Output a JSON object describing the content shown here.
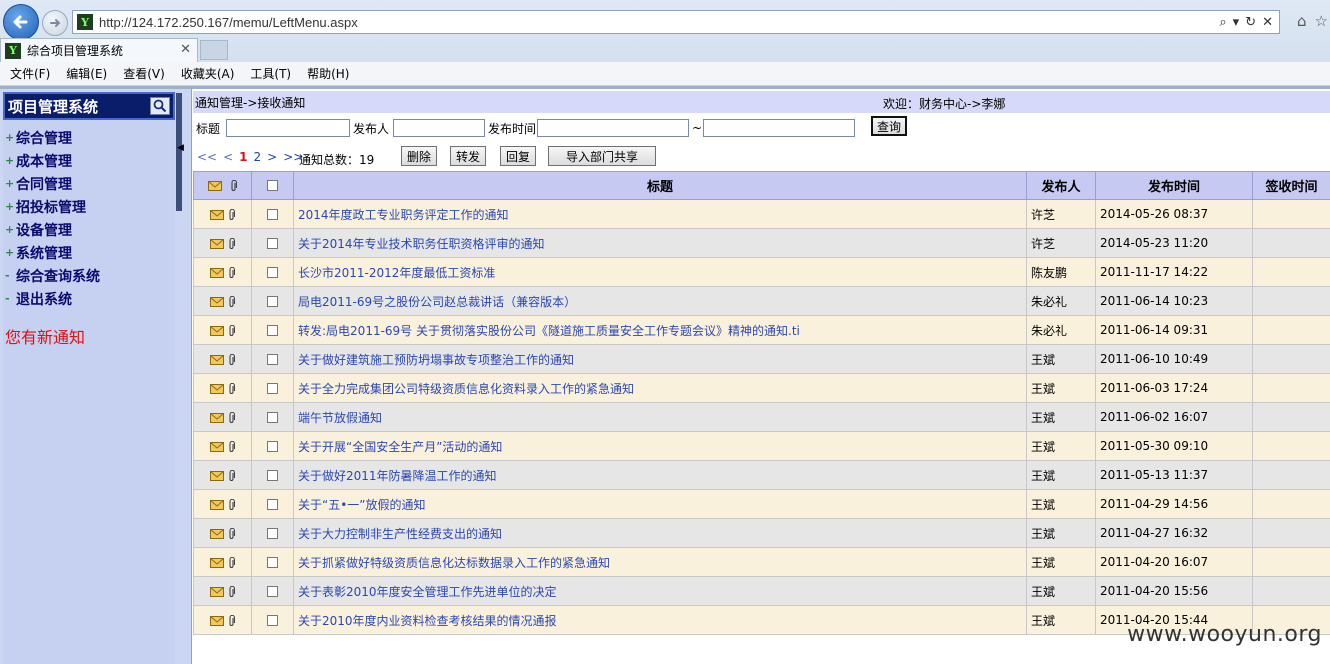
{
  "browser": {
    "url": "http://124.172.250.167/memu/LeftMenu.aspx",
    "tab_title": "综合项目管理系统",
    "favicon_text": "Y"
  },
  "menu": [
    "文件(F)",
    "编辑(E)",
    "查看(V)",
    "收藏夹(A)",
    "工具(T)",
    "帮助(H)"
  ],
  "sidebar": {
    "title": "项目管理系统",
    "items": [
      {
        "label": "综合管理",
        "toggle": "+"
      },
      {
        "label": "成本管理",
        "toggle": "+"
      },
      {
        "label": "合同管理",
        "toggle": "+"
      },
      {
        "label": "招投标管理",
        "toggle": "+"
      },
      {
        "label": "设备管理",
        "toggle": "+"
      },
      {
        "label": "系统管理",
        "toggle": "+"
      },
      {
        "label": "综合查询系统",
        "toggle": "-"
      },
      {
        "label": "退出系统",
        "toggle": "-"
      }
    ],
    "notice": "您有新通知"
  },
  "header": {
    "breadcrumb": "通知管理->接收通知",
    "welcome": "欢迎：财务中心->李娜"
  },
  "filters": {
    "title_label": "标题",
    "publisher_label": "发布人",
    "time_label": "发布时间",
    "range_sep": "~",
    "query_button": "查询"
  },
  "pager": {
    "first": "<<",
    "prev": "<",
    "current": "1",
    "page2": "2",
    "next": ">",
    "last": ">>",
    "total_label": "通知总数：19"
  },
  "actions": {
    "delete": "删除",
    "forward": "转发",
    "reply": "回复",
    "import_share": "导入部门共享"
  },
  "table": {
    "columns": [
      "标题",
      "发布人",
      "发布时间",
      "签收时间"
    ],
    "rows": [
      {
        "title": "2014年度政工专业职务评定工作的通知",
        "publisher": "许芝",
        "time": "2014-05-26 08:37",
        "signed": ""
      },
      {
        "title": "关于2014年专业技术职务任职资格评审的通知",
        "publisher": "许芝",
        "time": "2014-05-23 11:20",
        "signed": ""
      },
      {
        "title": "长沙市2011-2012年度最低工资标准",
        "publisher": "陈友鹏",
        "time": "2011-11-17 14:22",
        "signed": ""
      },
      {
        "title": "局电2011-69号之股份公司赵总裁讲话（兼容版本）",
        "publisher": "朱必礼",
        "time": "2011-06-14 10:23",
        "signed": ""
      },
      {
        "title": "转发:局电2011-69号 关于贯彻落实股份公司《隧道施工质量安全工作专题会议》精神的通知.ti",
        "publisher": "朱必礼",
        "time": "2011-06-14 09:31",
        "signed": ""
      },
      {
        "title": "关于做好建筑施工预防坍塌事故专项整治工作的通知",
        "publisher": "王斌",
        "time": "2011-06-10 10:49",
        "signed": ""
      },
      {
        "title": "关于全力完成集团公司特级资质信息化资料录入工作的紧急通知",
        "publisher": "王斌",
        "time": "2011-06-03 17:24",
        "signed": ""
      },
      {
        "title": "端午节放假通知",
        "publisher": "王斌",
        "time": "2011-06-02 16:07",
        "signed": ""
      },
      {
        "title": "关于开展“全国安全生产月”活动的通知",
        "publisher": "王斌",
        "time": "2011-05-30 09:10",
        "signed": ""
      },
      {
        "title": "关于做好2011年防暑降温工作的通知",
        "publisher": "王斌",
        "time": "2011-05-13 11:37",
        "signed": ""
      },
      {
        "title": "关于“五•一”放假的通知",
        "publisher": "王斌",
        "time": "2011-04-29 14:56",
        "signed": ""
      },
      {
        "title": "关于大力控制非生产性经费支出的通知",
        "publisher": "王斌",
        "time": "2011-04-27 16:32",
        "signed": ""
      },
      {
        "title": "关于抓紧做好特级资质信息化达标数据录入工作的紧急通知",
        "publisher": "王斌",
        "time": "2011-04-20 16:07",
        "signed": ""
      },
      {
        "title": "关于表彰2010年度安全管理工作先进单位的决定",
        "publisher": "王斌",
        "time": "2011-04-20 15:56",
        "signed": ""
      },
      {
        "title": "关于2010年度内业资料检查考核结果的情况通报",
        "publisher": "王斌",
        "time": "2011-04-20 15:44",
        "signed": ""
      }
    ]
  },
  "watermark": "www.wooyun.org",
  "colors": {
    "sidebar_header": "#0a1d6a",
    "row_odd": "#faf1dc",
    "row_even": "#e6e6e6",
    "link": "#2a47b5",
    "notice": "#e01010"
  }
}
